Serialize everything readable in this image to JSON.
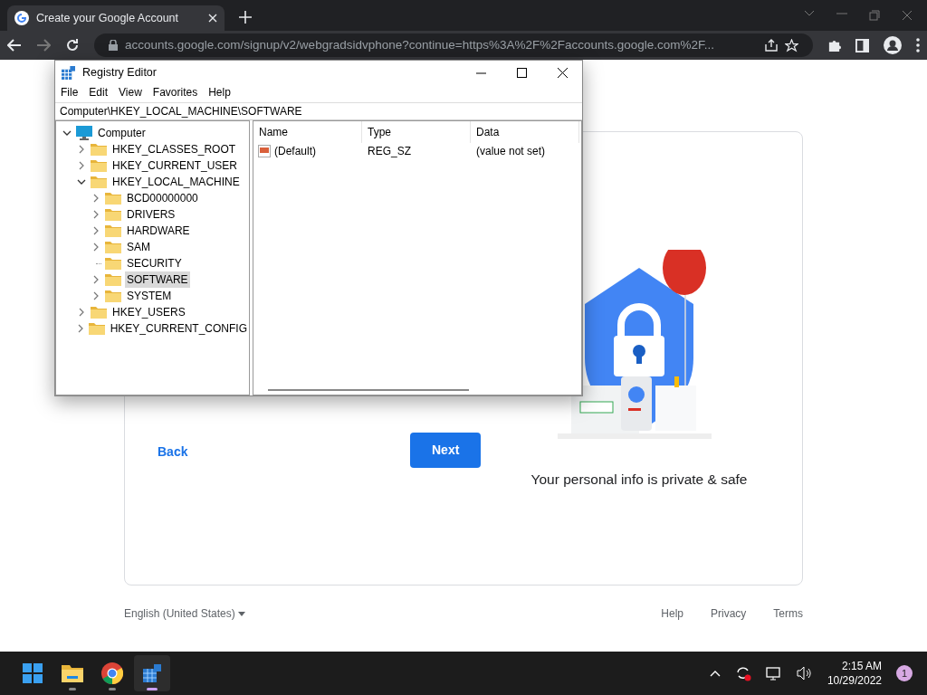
{
  "browser": {
    "tab": {
      "title": "Create your Google Account",
      "selected": true
    },
    "url": "accounts.google.com/signup/v2/webgradsidvphone?continue=https%3A%2F%2Faccounts.google.com%2F...",
    "page": {
      "back": "Back",
      "next": "Next",
      "caption": "Your personal info is private & safe",
      "language": "English (United States)",
      "footer_links": [
        "Help",
        "Privacy",
        "Terms"
      ]
    }
  },
  "regedit": {
    "title": "Registry Editor",
    "menu": [
      "File",
      "Edit",
      "View",
      "Favorites",
      "Help"
    ],
    "address": "Computer\\HKEY_LOCAL_MACHINE\\SOFTWARE",
    "tree": [
      {
        "label": "Computer",
        "kind": "computer",
        "expandable": true,
        "expanded": true,
        "selected": false,
        "children": [
          {
            "label": "HKEY_CLASSES_ROOT",
            "kind": "folder",
            "expandable": true,
            "expanded": false,
            "selected": false
          },
          {
            "label": "HKEY_CURRENT_USER",
            "kind": "folder",
            "expandable": true,
            "expanded": false,
            "selected": false
          },
          {
            "label": "HKEY_LOCAL_MACHINE",
            "kind": "folder",
            "expandable": true,
            "expanded": true,
            "selected": false,
            "children": [
              {
                "label": "BCD00000000",
                "kind": "folder",
                "expandable": true,
                "expanded": false,
                "selected": false
              },
              {
                "label": "DRIVERS",
                "kind": "folder",
                "expandable": true,
                "expanded": false,
                "selected": false
              },
              {
                "label": "HARDWARE",
                "kind": "folder",
                "expandable": true,
                "expanded": false,
                "selected": false
              },
              {
                "label": "SAM",
                "kind": "folder",
                "expandable": true,
                "expanded": false,
                "selected": false
              },
              {
                "label": "SECURITY",
                "kind": "folder",
                "expandable": false,
                "expanded": false,
                "selected": false
              },
              {
                "label": "SOFTWARE",
                "kind": "folder",
                "expandable": true,
                "expanded": false,
                "selected": true
              },
              {
                "label": "SYSTEM",
                "kind": "folder",
                "expandable": true,
                "expanded": false,
                "selected": false
              }
            ]
          },
          {
            "label": "HKEY_USERS",
            "kind": "folder",
            "expandable": true,
            "expanded": false,
            "selected": false
          },
          {
            "label": "HKEY_CURRENT_CONFIG",
            "kind": "folder",
            "expandable": true,
            "expanded": false,
            "selected": false
          }
        ]
      }
    ],
    "columns": [
      "Name",
      "Type",
      "Data"
    ],
    "rows": [
      {
        "name": "(Default)",
        "type": "REG_SZ",
        "data": "(value not set)"
      }
    ]
  },
  "taskbar": {
    "apps": [
      {
        "kind": "start",
        "active": false
      },
      {
        "kind": "explorer",
        "active": false
      },
      {
        "kind": "chrome",
        "active": false
      },
      {
        "kind": "regedit",
        "active": true
      }
    ],
    "time": "2:15 AM",
    "date": "10/29/2022",
    "notifications": "1"
  }
}
